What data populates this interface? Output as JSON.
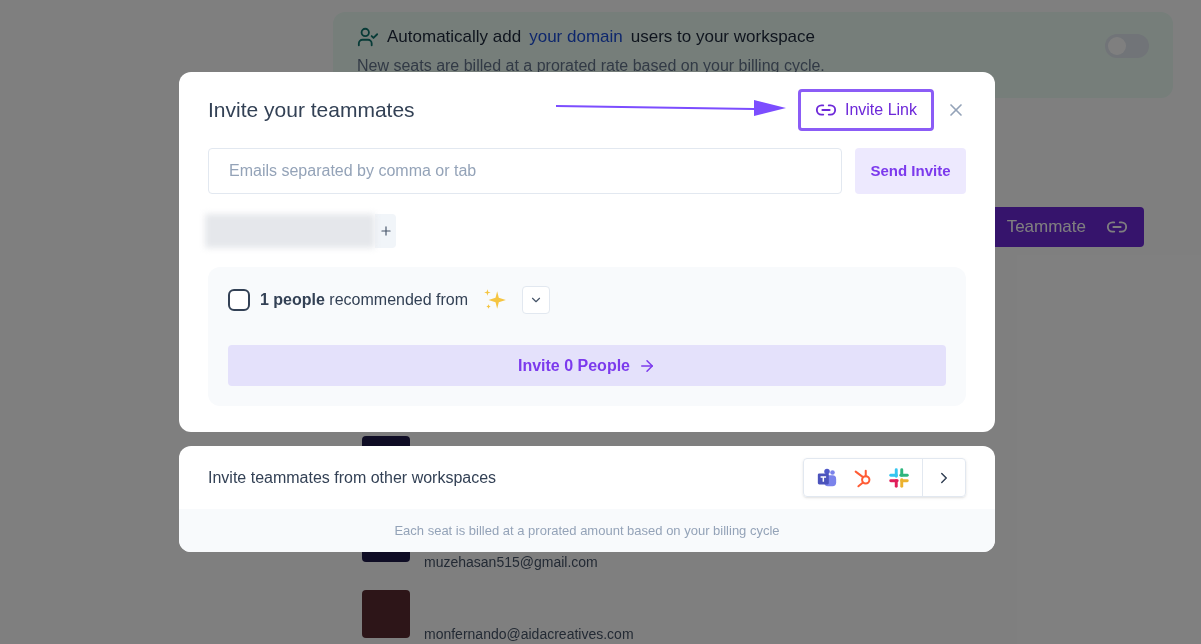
{
  "background": {
    "banner": {
      "title_start": "Automatically add",
      "link": "your domain",
      "title_end": "users to your workspace",
      "subtitle": "New seats are billed at a prorated rate based on your billing cycle.",
      "toggle_on": false
    },
    "add_button": {
      "label": "Teammate"
    },
    "members": [
      {
        "photo": false
      },
      {
        "email": "muzehasan515@gmail.com",
        "photo": false
      },
      {
        "email": "monfernando@aidacreatives.com",
        "photo": true
      }
    ]
  },
  "invite_modal": {
    "title": "Invite your teammates",
    "invite_link": "Invite Link",
    "highlighted": true,
    "email_field": {
      "placeholder": "Emails separated by comma or tab"
    },
    "send_button": {
      "label": "Send Invite",
      "disabled": true
    },
    "recommendation": {
      "checked": false,
      "text": "**1 people** recommended from",
      "expanded": false
    },
    "invite_button": {
      "label": "Invite 0 People",
      "disabled": true
    }
  },
  "workspaces_panel": {
    "title": "Invite teammates from other workspaces",
    "note": "Each seat is billed at a prorated amount based on your billing cycle"
  }
}
